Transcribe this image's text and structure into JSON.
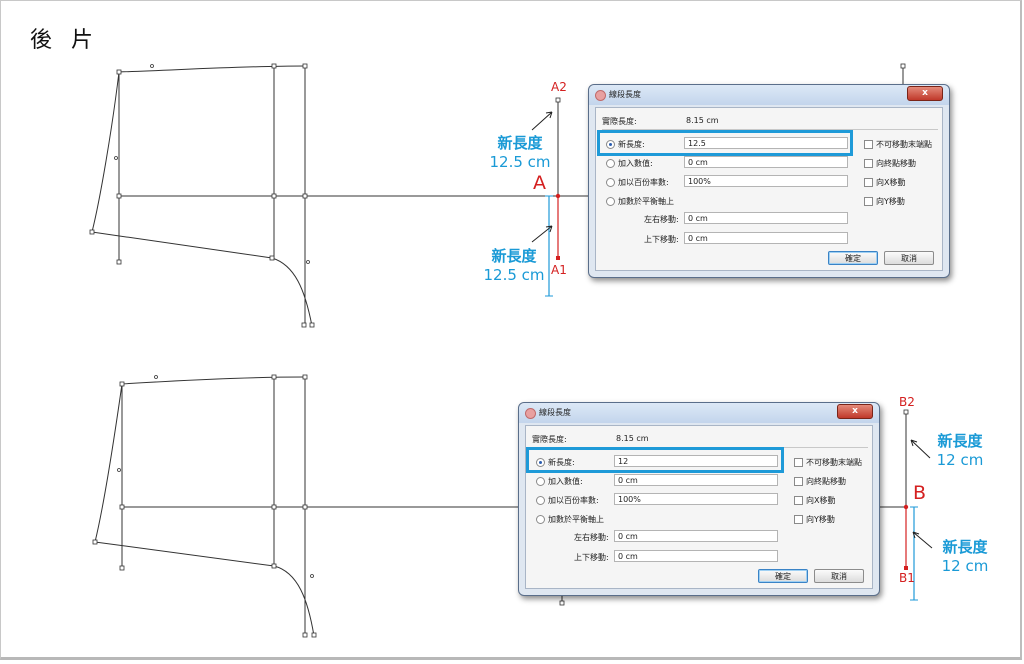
{
  "page_title": "後 片",
  "top": {
    "point_top": "A2",
    "point_mid": "A",
    "point_bottom": "A1",
    "annot_upper": {
      "label": "新長度",
      "value": "12.5 cm"
    },
    "annot_lower": {
      "label": "新長度",
      "value": "12.5 cm"
    },
    "dialog": {
      "title": "線段長度",
      "close": "x",
      "actual_length_label": "實際長度:",
      "actual_length_value": "8.15 cm",
      "options": [
        {
          "label": "新長度:",
          "value": "12.5",
          "selected": true
        },
        {
          "label": "加入數值:",
          "value": "0 cm",
          "selected": false
        },
        {
          "label": "加以百份率數:",
          "value": "100%",
          "selected": false
        },
        {
          "label": "加數於平衡軸上",
          "value": "",
          "selected": false
        }
      ],
      "move_lr_label": "左右移動:",
      "move_lr_value": "0 cm",
      "move_ud_label": "上下移動:",
      "move_ud_value": "0 cm",
      "checkboxes": [
        "不可移動末端點",
        "向終點移動",
        "向X移動",
        "向Y移動"
      ],
      "ok": "確定",
      "cancel": "取消"
    }
  },
  "bottom": {
    "point_top": "B2",
    "point_mid": "B",
    "point_bottom": "B1",
    "annot_upper": {
      "label": "新長度",
      "value": "12 cm"
    },
    "annot_lower": {
      "label": "新長度",
      "value": "12 cm"
    },
    "dialog": {
      "title": "線段長度",
      "close": "x",
      "actual_length_label": "實際長度:",
      "actual_length_value": "8.15 cm",
      "options": [
        {
          "label": "新長度:",
          "value": "12",
          "selected": true
        },
        {
          "label": "加入數值:",
          "value": "0 cm",
          "selected": false
        },
        {
          "label": "加以百份率數:",
          "value": "100%",
          "selected": false
        },
        {
          "label": "加數於平衡軸上",
          "value": "",
          "selected": false
        }
      ],
      "move_lr_label": "左右移動:",
      "move_lr_value": "0 cm",
      "move_ud_label": "上下移動:",
      "move_ud_value": "0 cm",
      "checkboxes": [
        "不可移動末端點",
        "向終點移動",
        "向X移動",
        "向Y移動"
      ],
      "ok": "確定",
      "cancel": "取消"
    }
  },
  "colors": {
    "accent": "#1e9ad8",
    "point": "#d42020",
    "line": "#333333"
  }
}
